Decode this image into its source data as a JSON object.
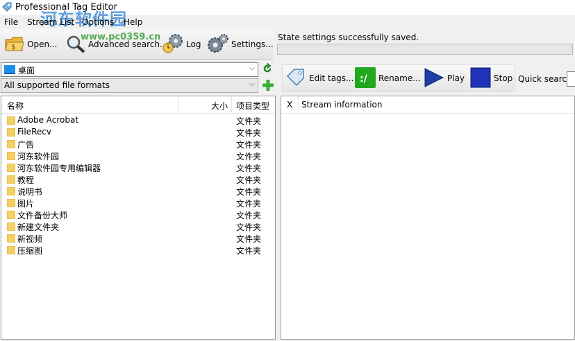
{
  "window": {
    "title": "Professional Tag Editor"
  },
  "watermark": {
    "text": "河东软件园",
    "url": "www.pc0359.cn"
  },
  "menu": [
    "File",
    "Stream List",
    "Options",
    "Help"
  ],
  "toolbar": {
    "open": "Open...",
    "advanced_search": "Advanced search...",
    "log": "Log",
    "settings": "Settings..."
  },
  "status": {
    "message": "State settings successfully saved.",
    "progress": 0
  },
  "location": {
    "value": "桌面"
  },
  "filter": {
    "value": "All supported file formats"
  },
  "file_list": {
    "columns": {
      "name": "名称",
      "size": "大小",
      "type": "项目类型"
    },
    "rows": [
      {
        "name": "Adobe Acrobat",
        "type": "文件夹"
      },
      {
        "name": "FileRecv",
        "type": "文件夹"
      },
      {
        "name": "广告",
        "type": "文件夹"
      },
      {
        "name": "河东软件园",
        "type": "文件夹"
      },
      {
        "name": "河东软件园专用编辑器",
        "type": "文件夹"
      },
      {
        "name": "教程",
        "type": "文件夹"
      },
      {
        "name": "说明书",
        "type": "文件夹"
      },
      {
        "name": "图片",
        "type": "文件夹"
      },
      {
        "name": "文件备份大师",
        "type": "文件夹"
      },
      {
        "name": "新建文件夹",
        "type": "文件夹"
      },
      {
        "name": "新视频",
        "type": "文件夹"
      },
      {
        "name": "压缩图",
        "type": "文件夹"
      }
    ]
  },
  "right_toolbar": {
    "edit_tags": "Edit tags...",
    "rename": "Rename...",
    "play": "Play",
    "stop": "Stop",
    "quick_search_label": "Quick search:",
    "quick_search_value": ""
  },
  "tag_table": {
    "columns": {
      "x": "X",
      "stream_info": "Stream information"
    }
  },
  "colors": {
    "folder": "#f4cf63",
    "progress": "#3bb143",
    "watermark": "#2c7fd2",
    "play": "#1f3fa6",
    "rename": "#22a81e"
  }
}
